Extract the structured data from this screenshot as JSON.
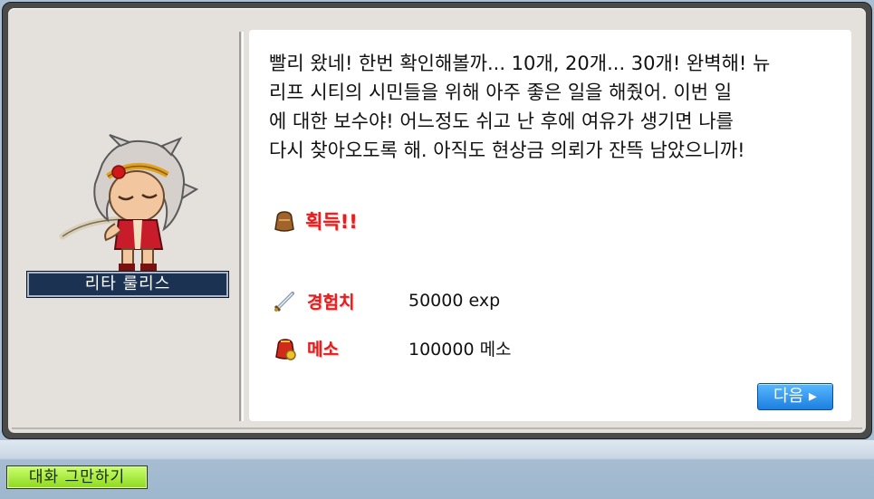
{
  "npc": {
    "name": "리타 룰리스"
  },
  "dialog": {
    "lines": [
      "빨리 왔네! 한번 확인해볼까... 10개, 20개... 30개! 완벽해! 뉴",
      " 리프 시티의 시민들을 위해 아주 좋은 일을 해줬어. 이번 일",
      "에 대한 보수야! 어느정도 쉬고 난 후에 여유가 생기면 나를",
      "다시 찾아오도록 해. 아직도 현상금 의뢰가 잔뜩 남았으니까!"
    ],
    "reward_title": "획득!!",
    "rewards": [
      {
        "label": "경험치",
        "value": "50000 exp",
        "icon": "sword-icon"
      },
      {
        "label": "메소",
        "value": "100000 메소",
        "icon": "meso-bag-icon"
      }
    ],
    "next_label": "다음 ▸"
  },
  "bottom_bar": {
    "end_chat_label": "대화 그만하기"
  },
  "colors": {
    "reward_label": "#e02020",
    "name_tag_bg": "#1c3252",
    "next_button": "#1d7fe0",
    "end_chat_button": "#8ed81e"
  }
}
